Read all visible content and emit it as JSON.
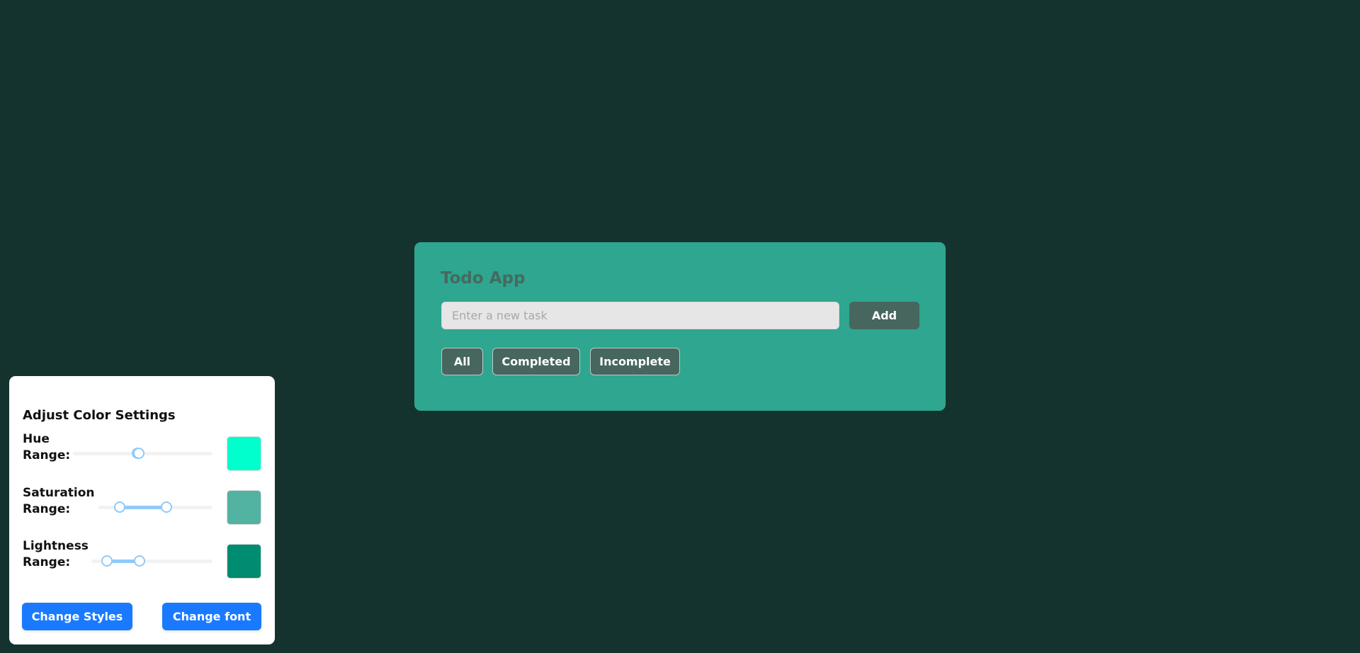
{
  "todo": {
    "title": "Todo App",
    "input_placeholder": "Enter a new task",
    "input_value": "",
    "add_label": "Add",
    "filters": [
      "All",
      "Completed",
      "Incomplete"
    ]
  },
  "color_panel": {
    "title": "Adjust Color Settings",
    "sliders": [
      {
        "label_line1": "Hue",
        "label_line2": "Range:",
        "range": [
          46,
          47
        ],
        "swatch": "#00ffcc"
      },
      {
        "label_line1": "Saturation",
        "label_line2": "Range:",
        "range": [
          19,
          60
        ],
        "swatch": "#52b3a3"
      },
      {
        "label_line1": "Lightness",
        "label_line2": "Range:",
        "range": [
          13,
          40
        ],
        "swatch": "#008c70"
      }
    ],
    "change_styles_label": "Change Styles",
    "change_font_label": "Change font"
  },
  "colors": {
    "background": "#15332e",
    "card": "#2ea690",
    "dark_button": "#46665e",
    "primary": "#1a7aff"
  }
}
